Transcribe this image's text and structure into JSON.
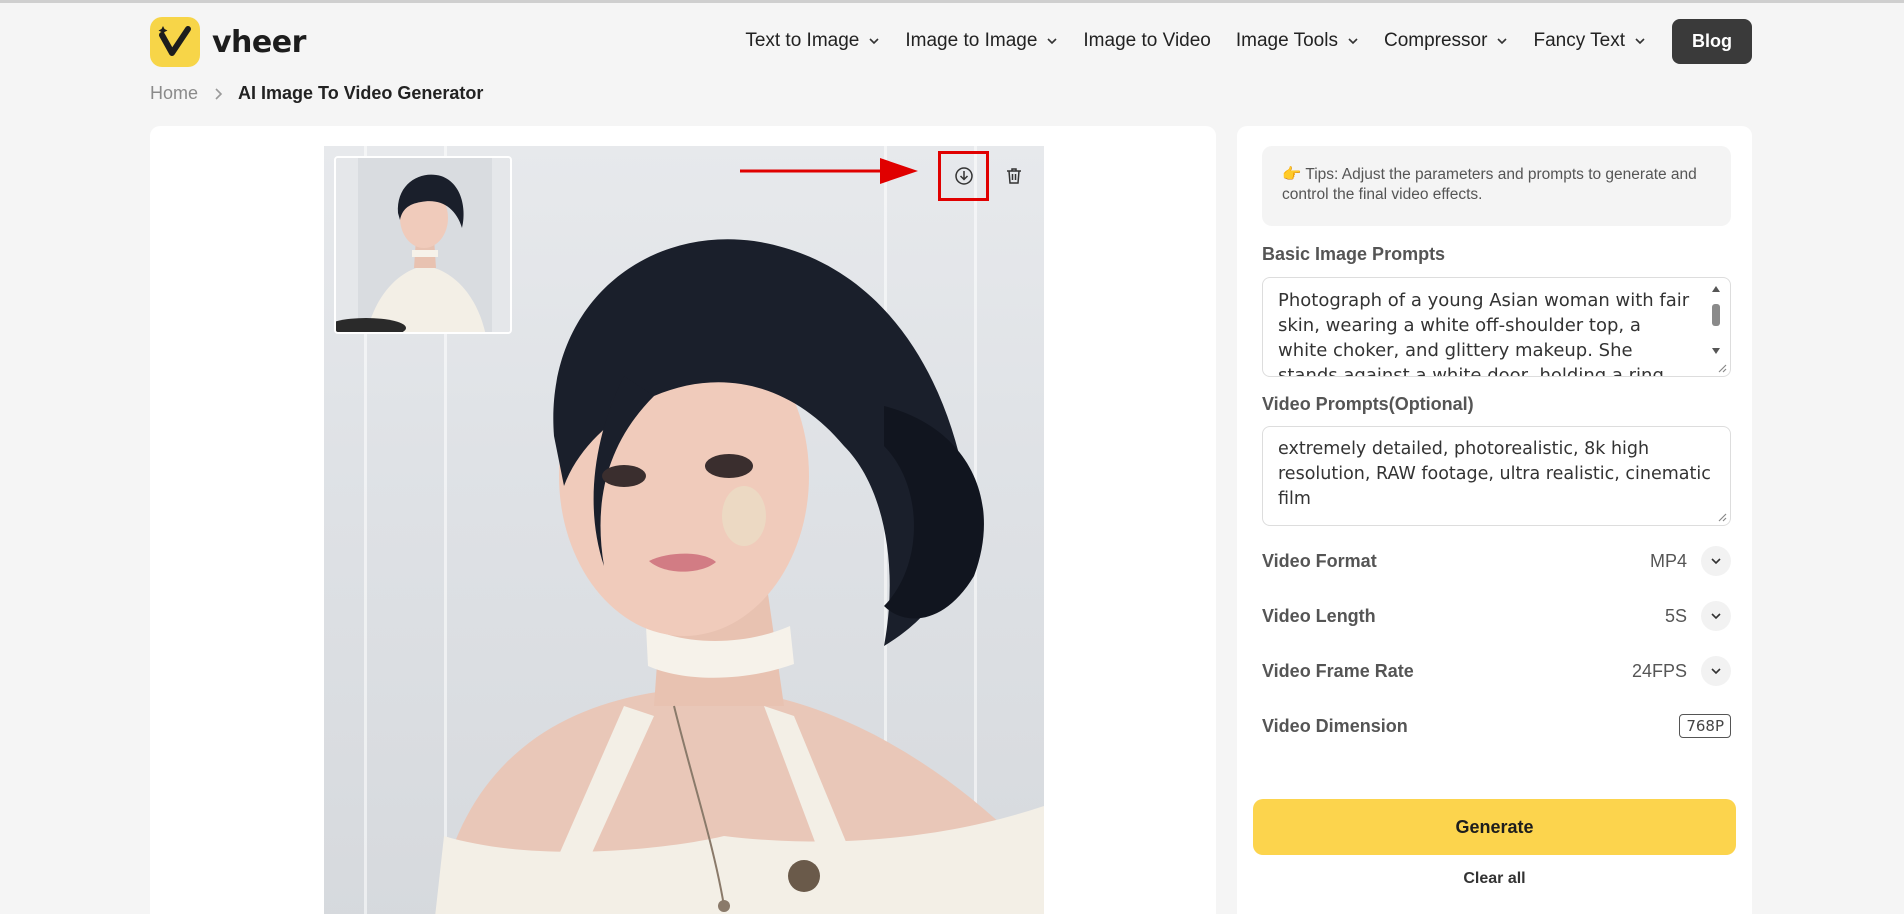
{
  "header": {
    "logo_text": "vheer",
    "nav": [
      {
        "label": "Text to Image",
        "dropdown": true
      },
      {
        "label": "Image to Image",
        "dropdown": true
      },
      {
        "label": "Image to Video",
        "dropdown": false
      },
      {
        "label": "Image Tools",
        "dropdown": true
      },
      {
        "label": "Compressor",
        "dropdown": true
      },
      {
        "label": "Fancy Text",
        "dropdown": true
      }
    ],
    "blog_label": "Blog"
  },
  "breadcrumb": {
    "home": "Home",
    "current": "AI Image To Video Generator"
  },
  "preview": {
    "download_icon": "download-icon",
    "delete_icon": "trash-icon"
  },
  "panel": {
    "tips": "👉 Tips: Adjust the parameters and prompts to generate and control the final video effects.",
    "basic_prompts_label": "Basic Image Prompts",
    "basic_prompts_value": "Photograph of a young Asian woman with fair skin, wearing a white off-shoulder top, a white choker, and glittery makeup. She stands against a white door, holding a ring light in",
    "video_prompts_label": "Video Prompts(Optional)",
    "video_prompts_value": "extremely detailed, photorealistic, 8k high resolution, RAW footage, ultra realistic, cinematic film",
    "format_label": "Video Format",
    "format_value": "MP4",
    "length_label": "Video Length",
    "length_value": "5S",
    "framerate_label": "Video Frame Rate",
    "framerate_value": "24FPS",
    "dimension_label": "Video Dimension",
    "dimension_value": "768P",
    "generate_label": "Generate",
    "clear_label": "Clear all"
  },
  "colors": {
    "accent_yellow": "#fcd44d",
    "highlight_red": "#e00000",
    "blog_bg": "#3a3a3a"
  }
}
